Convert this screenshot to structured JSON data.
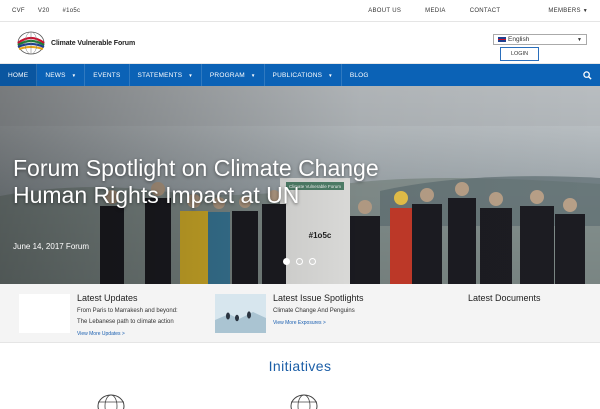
{
  "topbar": {
    "left": [
      "CVF",
      "V20",
      "#1o5c"
    ],
    "right": [
      "ABOUT US",
      "MEDIA",
      "CONTACT",
      "MEMBERS"
    ]
  },
  "header": {
    "logo_text": "Climate Vulnerable Forum",
    "language": "English",
    "login_label": "LOGIN"
  },
  "nav": {
    "items": [
      {
        "label": "HOME",
        "dropdown": false,
        "active": true
      },
      {
        "label": "NEWS",
        "dropdown": true,
        "active": false
      },
      {
        "label": "EVENTS",
        "dropdown": false,
        "active": false
      },
      {
        "label": "STATEMENTS",
        "dropdown": true,
        "active": false
      },
      {
        "label": "PROGRAM",
        "dropdown": true,
        "active": false
      },
      {
        "label": "PUBLICATIONS",
        "dropdown": true,
        "active": false
      },
      {
        "label": "BLOG",
        "dropdown": false,
        "active": false
      }
    ],
    "search_icon": "search-icon",
    "color": "#0b62b6"
  },
  "hero": {
    "title": "Forum Spotlight on Climate Change Human Rights Impact at UN",
    "meta": "June 14, 2017 Forum",
    "banner_text": "Climate Vulnerable Forum",
    "slides_total": 3,
    "slide_active": 1
  },
  "updates": {
    "latest": {
      "heading": "Latest Updates",
      "line1": "From Paris to Marrakesh and beyond:",
      "line2": "The Lebanese path to climate action",
      "more": "View More Updates >"
    },
    "issue": {
      "heading": "Latest Issue Spotlights",
      "line1": "Climate Change And Penguins",
      "more": "View More Exposures >"
    },
    "documents": {
      "heading": "Latest Documents"
    }
  },
  "initiatives": {
    "heading": "Initiatives"
  }
}
